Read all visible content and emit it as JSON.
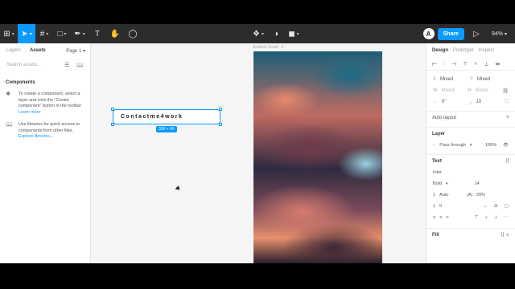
{
  "toolbar": {
    "main_menu_icon": "figma-menu-icon",
    "zoom": "94%",
    "share_label": "Share",
    "avatar_initial": "A"
  },
  "left_panel": {
    "tab_layers": "Layers",
    "tab_assets": "Assets",
    "page_label": "Page 1",
    "search_placeholder": "Search assets...",
    "components_title": "Components",
    "info1_text": "To create a component, select a layer and click the “Create component” button in the toolbar.",
    "info1_link": "Learn more",
    "info2_text": "Use libraries for quick access to components from other files.",
    "info2_link": "Explore libraries..."
  },
  "canvas": {
    "selected_text": "Contactme4work",
    "selection_size": "300 × 40",
    "frame_label": "Android Small - 3"
  },
  "right_panel": {
    "tab_design": "Design",
    "tab_prototype": "Prototype",
    "tab_inspect": "Inspect",
    "x_label": "X",
    "x_value": "Mixed",
    "y_label": "Y",
    "y_value": "Mixed",
    "w_label": "W",
    "w_value": "Mixed",
    "h_label": "H",
    "h_value": "Mixed",
    "rotation_value": "0°",
    "radius_value": "10",
    "auto_layout": "Auto layout",
    "layer_title": "Layer",
    "blend_mode": "Pass through",
    "opacity": "100%",
    "text_title": "Text",
    "font_family": "Inter",
    "font_weight": "Bold",
    "font_size": "14",
    "line_height": "Auto",
    "letter_spacing": "20%",
    "paragraph_spacing": "0",
    "fill_title": "Fill"
  }
}
